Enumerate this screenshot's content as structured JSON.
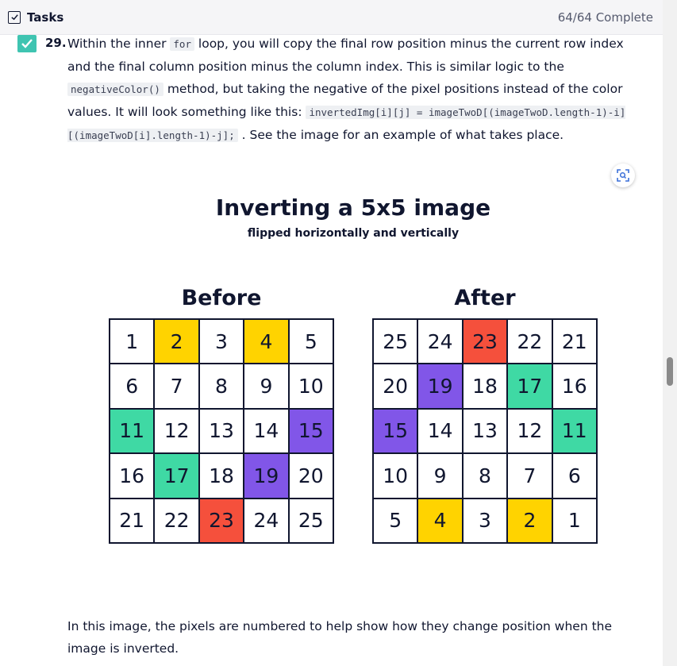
{
  "header": {
    "title": "Tasks",
    "count": "64/64 Complete"
  },
  "step": {
    "number": "29.",
    "t1": "Within the inner ",
    "c1": "for",
    "t2": " loop, you will copy the final row position minus the current row index and the final column position minus the column index. This is similar logic to the ",
    "c2": "negativeColor()",
    "t3": " method, but taking the negative of the pixel positions instead of the color values. It will look something like this: ",
    "c3": "invertedImg[i][j] = imageTwoD[(imageTwoD.length-1)-i][(imageTwoD[i].length-1)-j];",
    "t4": " . See the image for an example of what takes place."
  },
  "figure": {
    "title": "Inverting a 5x5 image",
    "subtitle": "flipped horizontally and vertically",
    "before_label": "Before",
    "after_label": "After",
    "colors": {
      "yellow": "#ffd300",
      "green": "#3fd9a4",
      "purple": "#8156e8",
      "red": "#f5503c"
    },
    "before": [
      [
        {
          "v": "1"
        },
        {
          "v": "2",
          "c": "yellow"
        },
        {
          "v": "3"
        },
        {
          "v": "4",
          "c": "yellow"
        },
        {
          "v": "5"
        }
      ],
      [
        {
          "v": "6"
        },
        {
          "v": "7"
        },
        {
          "v": "8"
        },
        {
          "v": "9"
        },
        {
          "v": "10"
        }
      ],
      [
        {
          "v": "11",
          "c": "green"
        },
        {
          "v": "12"
        },
        {
          "v": "13"
        },
        {
          "v": "14"
        },
        {
          "v": "15",
          "c": "purple"
        }
      ],
      [
        {
          "v": "16"
        },
        {
          "v": "17",
          "c": "green"
        },
        {
          "v": "18"
        },
        {
          "v": "19",
          "c": "purple"
        },
        {
          "v": "20"
        }
      ],
      [
        {
          "v": "21"
        },
        {
          "v": "22"
        },
        {
          "v": "23",
          "c": "red"
        },
        {
          "v": "24"
        },
        {
          "v": "25"
        }
      ]
    ],
    "after": [
      [
        {
          "v": "25"
        },
        {
          "v": "24"
        },
        {
          "v": "23",
          "c": "red"
        },
        {
          "v": "22"
        },
        {
          "v": "21"
        }
      ],
      [
        {
          "v": "20"
        },
        {
          "v": "19",
          "c": "purple"
        },
        {
          "v": "18"
        },
        {
          "v": "17",
          "c": "green"
        },
        {
          "v": "16"
        }
      ],
      [
        {
          "v": "15",
          "c": "purple"
        },
        {
          "v": "14"
        },
        {
          "v": "13"
        },
        {
          "v": "12"
        },
        {
          "v": "11",
          "c": "green"
        }
      ],
      [
        {
          "v": "10"
        },
        {
          "v": "9"
        },
        {
          "v": "8"
        },
        {
          "v": "7"
        },
        {
          "v": "6"
        }
      ],
      [
        {
          "v": "5"
        },
        {
          "v": "4",
          "c": "yellow"
        },
        {
          "v": "3"
        },
        {
          "v": "2",
          "c": "yellow"
        },
        {
          "v": "1"
        }
      ]
    ]
  },
  "caption": "In this image, the pixels are numbered to help show how they change position when the image is inverted."
}
